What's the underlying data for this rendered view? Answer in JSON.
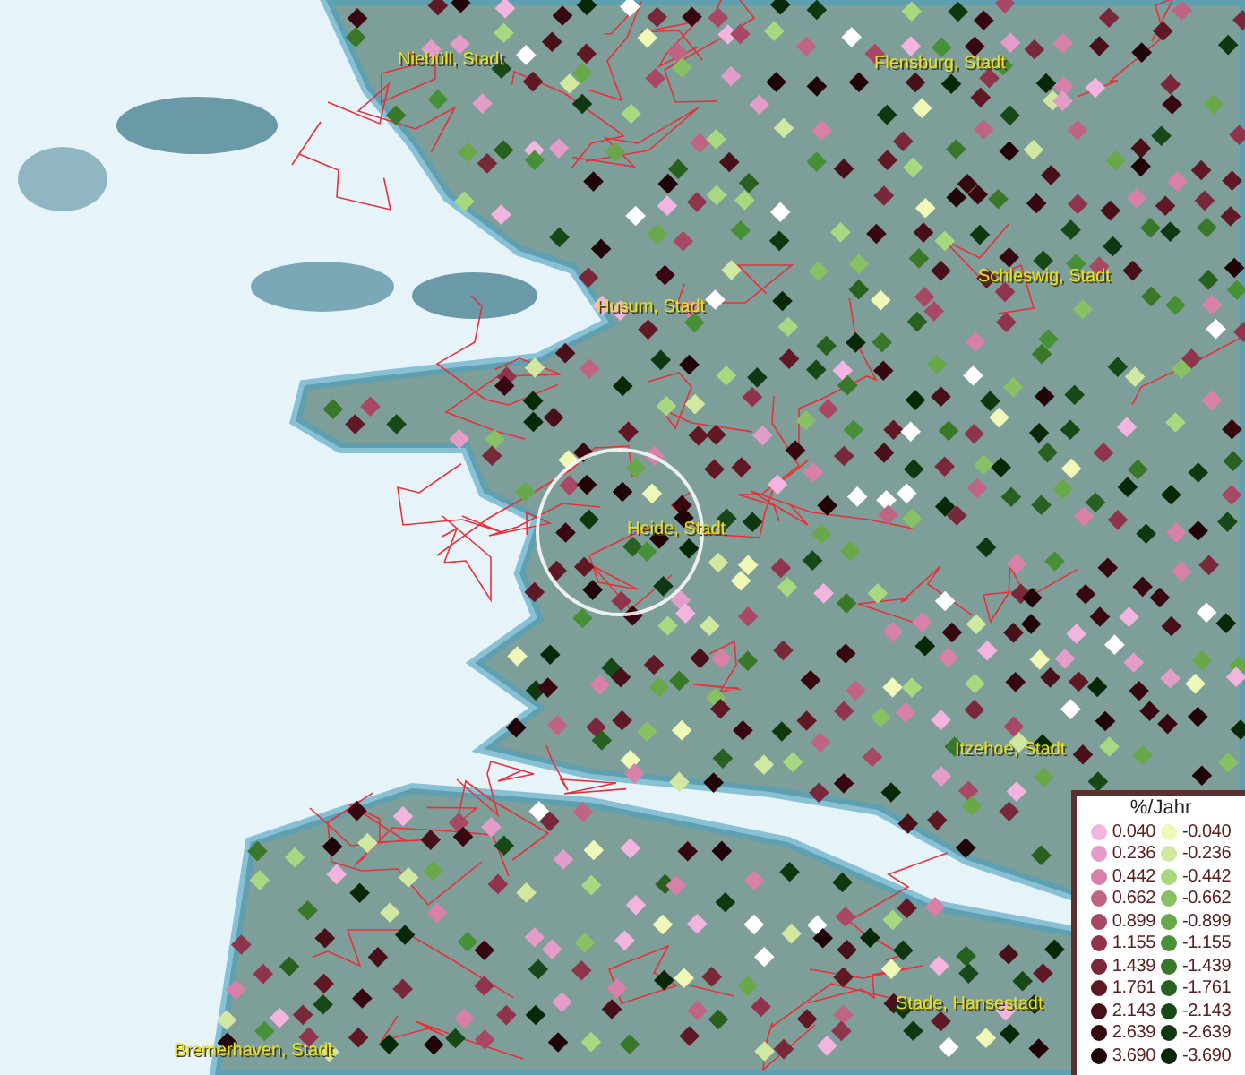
{
  "map": {
    "cities": [
      {
        "name": "Niebüll, Stadt"
      },
      {
        "name": "Flensburg, Stadt"
      },
      {
        "name": "Husum, Stadt"
      },
      {
        "name": "Schleswig, Stadt"
      },
      {
        "name": "Heide, Stadt"
      },
      {
        "name": "Itzehoe, Stadt"
      },
      {
        "name": "Stade, Hansestadt"
      },
      {
        "name": "Bremerhaven, Stadt"
      }
    ]
  },
  "legend": {
    "title": "%/Jahr",
    "positive": [
      {
        "label": "0.040",
        "color": "#f4b4e0"
      },
      {
        "label": "0.236",
        "color": "#e49cc8"
      },
      {
        "label": "0.442",
        "color": "#d880a8"
      },
      {
        "label": "0.662",
        "color": "#c06484"
      },
      {
        "label": "0.899",
        "color": "#a84864"
      },
      {
        "label": "1.155",
        "color": "#90344c"
      },
      {
        "label": "1.439",
        "color": "#782838"
      },
      {
        "label": "1.761",
        "color": "#601824"
      },
      {
        "label": "2.143",
        "color": "#481018"
      },
      {
        "label": "2.639",
        "color": "#380810"
      },
      {
        "label": "3.690",
        "color": "#200408"
      }
    ],
    "negative": [
      {
        "label": "-0.040",
        "color": "#f0f8b8"
      },
      {
        "label": "-0.236",
        "color": "#d0e8a0"
      },
      {
        "label": "-0.442",
        "color": "#a8d880"
      },
      {
        "label": "-0.662",
        "color": "#88c064"
      },
      {
        "label": "-0.899",
        "color": "#68a848"
      },
      {
        "label": "-1.155",
        "color": "#489038"
      },
      {
        "label": "-1.439",
        "color": "#387828"
      },
      {
        "label": "-1.761",
        "color": "#286020"
      },
      {
        "label": "-2.143",
        "color": "#184818"
      },
      {
        "label": "-2.639",
        "color": "#103810"
      },
      {
        "label": "-3.690",
        "color": "#082808"
      }
    ]
  }
}
